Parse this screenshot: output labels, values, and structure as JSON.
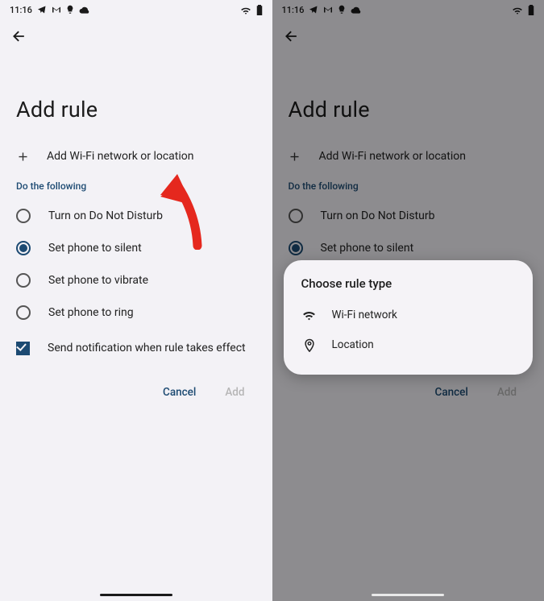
{
  "statusbar": {
    "time": "11:16"
  },
  "page": {
    "title": "Add rule"
  },
  "trigger": {
    "add_label": "Add Wi-Fi network or location"
  },
  "section": {
    "header": "Do the following"
  },
  "options": {
    "dnd": "Turn on Do Not Disturb",
    "silent": "Set phone to silent",
    "vibrate": "Set phone to vibrate",
    "ring": "Set phone to ring",
    "notify": "Send notification when rule takes effect"
  },
  "actions": {
    "cancel": "Cancel",
    "add": "Add"
  },
  "dialog": {
    "title": "Choose rule type",
    "wifi": "Wi-Fi network",
    "location": "Location"
  },
  "colors": {
    "accent": "#1c4a72"
  }
}
